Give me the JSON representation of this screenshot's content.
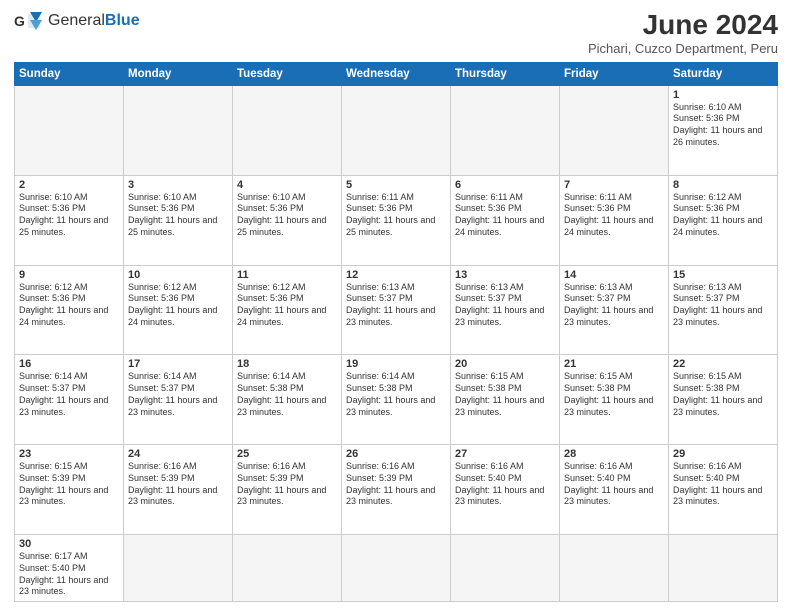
{
  "header": {
    "logo_general": "General",
    "logo_blue": "Blue",
    "month_year": "June 2024",
    "location": "Pichari, Cuzco Department, Peru"
  },
  "weekdays": [
    "Sunday",
    "Monday",
    "Tuesday",
    "Wednesday",
    "Thursday",
    "Friday",
    "Saturday"
  ],
  "weeks": [
    [
      {
        "day": "",
        "empty": true
      },
      {
        "day": "",
        "empty": true
      },
      {
        "day": "",
        "empty": true
      },
      {
        "day": "",
        "empty": true
      },
      {
        "day": "",
        "empty": true
      },
      {
        "day": "",
        "empty": true
      },
      {
        "day": "1",
        "sunrise": "6:10 AM",
        "sunset": "5:36 PM",
        "daylight": "11 hours and 26 minutes."
      }
    ],
    [
      {
        "day": "2",
        "sunrise": "6:10 AM",
        "sunset": "5:36 PM",
        "daylight": "11 hours and 25 minutes."
      },
      {
        "day": "3",
        "sunrise": "6:10 AM",
        "sunset": "5:36 PM",
        "daylight": "11 hours and 25 minutes."
      },
      {
        "day": "4",
        "sunrise": "6:10 AM",
        "sunset": "5:36 PM",
        "daylight": "11 hours and 25 minutes."
      },
      {
        "day": "5",
        "sunrise": "6:11 AM",
        "sunset": "5:36 PM",
        "daylight": "11 hours and 25 minutes."
      },
      {
        "day": "6",
        "sunrise": "6:11 AM",
        "sunset": "5:36 PM",
        "daylight": "11 hours and 24 minutes."
      },
      {
        "day": "7",
        "sunrise": "6:11 AM",
        "sunset": "5:36 PM",
        "daylight": "11 hours and 24 minutes."
      },
      {
        "day": "8",
        "sunrise": "6:12 AM",
        "sunset": "5:36 PM",
        "daylight": "11 hours and 24 minutes."
      }
    ],
    [
      {
        "day": "9",
        "sunrise": "6:12 AM",
        "sunset": "5:36 PM",
        "daylight": "11 hours and 24 minutes."
      },
      {
        "day": "10",
        "sunrise": "6:12 AM",
        "sunset": "5:36 PM",
        "daylight": "11 hours and 24 minutes."
      },
      {
        "day": "11",
        "sunrise": "6:12 AM",
        "sunset": "5:36 PM",
        "daylight": "11 hours and 24 minutes."
      },
      {
        "day": "12",
        "sunrise": "6:13 AM",
        "sunset": "5:37 PM",
        "daylight": "11 hours and 23 minutes."
      },
      {
        "day": "13",
        "sunrise": "6:13 AM",
        "sunset": "5:37 PM",
        "daylight": "11 hours and 23 minutes."
      },
      {
        "day": "14",
        "sunrise": "6:13 AM",
        "sunset": "5:37 PM",
        "daylight": "11 hours and 23 minutes."
      },
      {
        "day": "15",
        "sunrise": "6:13 AM",
        "sunset": "5:37 PM",
        "daylight": "11 hours and 23 minutes."
      }
    ],
    [
      {
        "day": "16",
        "sunrise": "6:14 AM",
        "sunset": "5:37 PM",
        "daylight": "11 hours and 23 minutes."
      },
      {
        "day": "17",
        "sunrise": "6:14 AM",
        "sunset": "5:37 PM",
        "daylight": "11 hours and 23 minutes."
      },
      {
        "day": "18",
        "sunrise": "6:14 AM",
        "sunset": "5:38 PM",
        "daylight": "11 hours and 23 minutes."
      },
      {
        "day": "19",
        "sunrise": "6:14 AM",
        "sunset": "5:38 PM",
        "daylight": "11 hours and 23 minutes."
      },
      {
        "day": "20",
        "sunrise": "6:15 AM",
        "sunset": "5:38 PM",
        "daylight": "11 hours and 23 minutes."
      },
      {
        "day": "21",
        "sunrise": "6:15 AM",
        "sunset": "5:38 PM",
        "daylight": "11 hours and 23 minutes."
      },
      {
        "day": "22",
        "sunrise": "6:15 AM",
        "sunset": "5:38 PM",
        "daylight": "11 hours and 23 minutes."
      }
    ],
    [
      {
        "day": "23",
        "sunrise": "6:15 AM",
        "sunset": "5:39 PM",
        "daylight": "11 hours and 23 minutes."
      },
      {
        "day": "24",
        "sunrise": "6:16 AM",
        "sunset": "5:39 PM",
        "daylight": "11 hours and 23 minutes."
      },
      {
        "day": "25",
        "sunrise": "6:16 AM",
        "sunset": "5:39 PM",
        "daylight": "11 hours and 23 minutes."
      },
      {
        "day": "26",
        "sunrise": "6:16 AM",
        "sunset": "5:39 PM",
        "daylight": "11 hours and 23 minutes."
      },
      {
        "day": "27",
        "sunrise": "6:16 AM",
        "sunset": "5:40 PM",
        "daylight": "11 hours and 23 minutes."
      },
      {
        "day": "28",
        "sunrise": "6:16 AM",
        "sunset": "5:40 PM",
        "daylight": "11 hours and 23 minutes."
      },
      {
        "day": "29",
        "sunrise": "6:16 AM",
        "sunset": "5:40 PM",
        "daylight": "11 hours and 23 minutes."
      }
    ],
    [
      {
        "day": "30",
        "sunrise": "6:17 AM",
        "sunset": "5:40 PM",
        "daylight": "11 hours and 23 minutes."
      },
      {
        "day": "",
        "empty": true
      },
      {
        "day": "",
        "empty": true
      },
      {
        "day": "",
        "empty": true
      },
      {
        "day": "",
        "empty": true
      },
      {
        "day": "",
        "empty": true
      },
      {
        "day": "",
        "empty": true
      }
    ]
  ]
}
